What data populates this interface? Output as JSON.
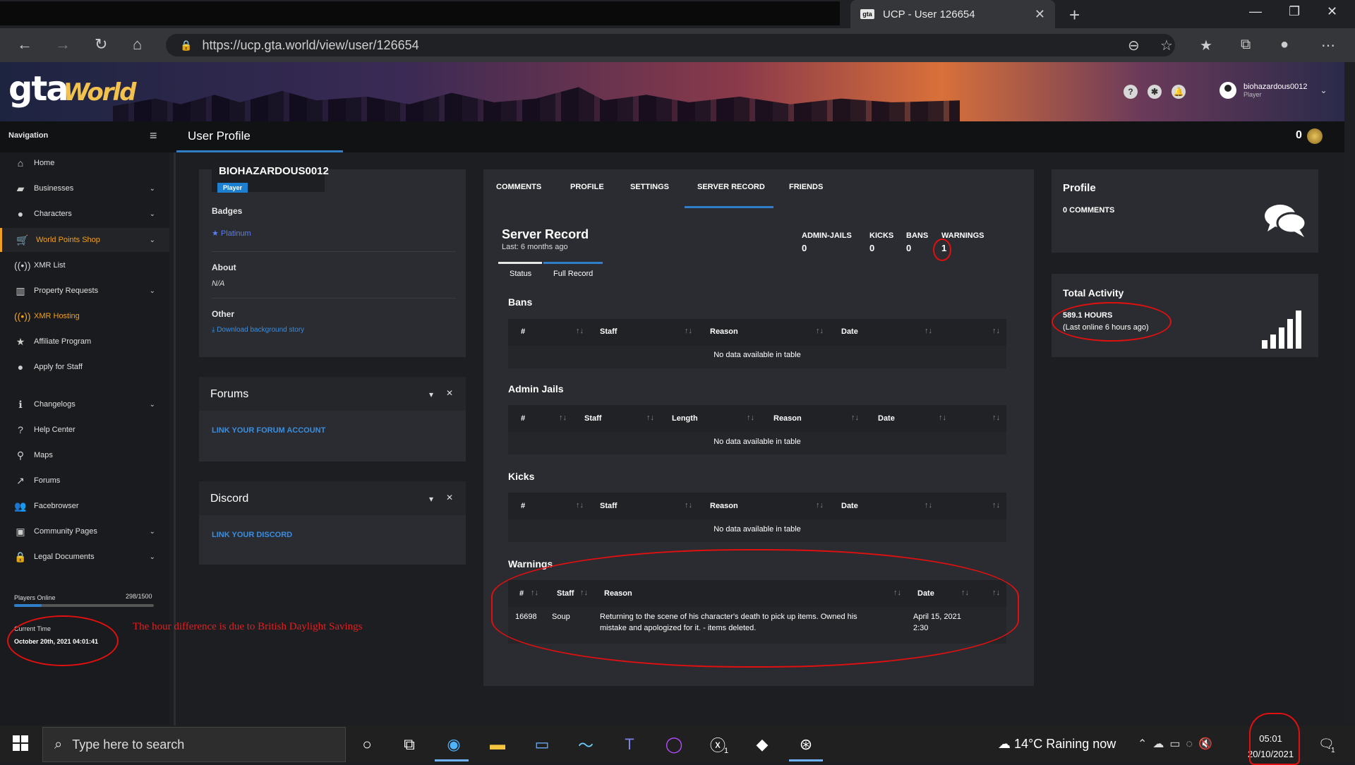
{
  "browser": {
    "tab_title": "UCP - User 126654",
    "favicon": "gta",
    "url": "https://ucp.gta.world/view/user/126654"
  },
  "header": {
    "logo_main": "gta",
    "logo_script": "World",
    "username": "biohazardous0012",
    "user_role": "Player"
  },
  "navbar": {
    "navigation_label": "Navigation",
    "page_title": "User Profile",
    "points": "0"
  },
  "sidebar": {
    "items": [
      {
        "label": "Home",
        "icon": "home-icon"
      },
      {
        "label": "Businesses",
        "icon": "briefcase-icon"
      },
      {
        "label": "Characters",
        "icon": "user-icon"
      },
      {
        "label": "World Points Shop",
        "icon": "cart-icon"
      },
      {
        "label": "XMR List",
        "icon": "broadcast-icon"
      },
      {
        "label": "Property Requests",
        "icon": "building-icon"
      },
      {
        "label": "XMR Hosting",
        "icon": "broadcast-icon"
      },
      {
        "label": "Affiliate Program",
        "icon": "star-icon"
      },
      {
        "label": "Apply for Staff",
        "icon": "user-tie-icon"
      },
      {
        "label": "Changelogs",
        "icon": "info-icon"
      },
      {
        "label": "Help Center",
        "icon": "question-icon"
      },
      {
        "label": "Maps",
        "icon": "map-pin-icon"
      },
      {
        "label": "Forums",
        "icon": "external-link-icon"
      },
      {
        "label": "Facebrowser",
        "icon": "users-icon"
      },
      {
        "label": "Community Pages",
        "icon": "window-icon"
      },
      {
        "label": "Legal Documents",
        "icon": "lock-icon"
      }
    ],
    "players_online_label": "Players Online",
    "players_online_count": "298/1500",
    "players_online_fraction": 0.199,
    "current_time_label": "Current Time",
    "current_time_value": "October 20th, 2021 04:01:41"
  },
  "annotation": {
    "note": "The hour difference is due to British Daylight Savings"
  },
  "profile_card": {
    "name": "BIOHAZARDOUS0012",
    "role": "Player",
    "badges_label": "Badges",
    "badge": "Platinum",
    "about_label": "About",
    "about_value": "N/A",
    "other_label": "Other",
    "download_link": "Download background story"
  },
  "forums_card": {
    "title": "Forums",
    "link": "LINK YOUR FORUM ACCOUNT"
  },
  "discord_card": {
    "title": "Discord",
    "link": "LINK YOUR DISCORD"
  },
  "center": {
    "tabs": [
      "COMMENTS",
      "PROFILE",
      "SETTINGS",
      "SERVER RECORD",
      "FRIENDS"
    ],
    "title": "Server Record",
    "subtitle": "Last: 6 months ago",
    "stats": [
      {
        "label": "ADMIN-JAILS",
        "value": "0"
      },
      {
        "label": "KICKS",
        "value": "0"
      },
      {
        "label": "BANS",
        "value": "0"
      },
      {
        "label": "WARNINGS",
        "value": "1"
      }
    ],
    "subtabs": [
      "Status",
      "Full Record"
    ],
    "no_data": "No data available in table",
    "bans": {
      "title": "Bans",
      "columns": [
        "#",
        "Staff",
        "Reason",
        "Date"
      ]
    },
    "jails": {
      "title": "Admin Jails",
      "columns": [
        "#",
        "Staff",
        "Length",
        "Reason",
        "Date"
      ]
    },
    "kicks": {
      "title": "Kicks",
      "columns": [
        "#",
        "Staff",
        "Reason",
        "Date"
      ]
    },
    "warnings": {
      "title": "Warnings",
      "columns": [
        "#",
        "Staff",
        "Reason",
        "Date"
      ],
      "rows": [
        {
          "id": "16698",
          "staff": "Soup",
          "reason_line1": "Returning to the scene of his character's death to pick up items. Owned his",
          "reason_line2": "mistake and apologized for it. - items deleted.",
          "date_line1": "April 15, 2021",
          "date_line2": "2:30"
        }
      ]
    }
  },
  "right": {
    "profile_title": "Profile",
    "comments": "0 COMMENTS",
    "activity_title": "Total Activity",
    "hours": "589.1 HOURS",
    "last_online": "(Last online 6 hours ago)"
  },
  "taskbar": {
    "search_placeholder": "Type here to search",
    "weather": "14°C  Raining now",
    "time": "05:01",
    "date": "20/10/2021",
    "xbox_badge": "1",
    "notif_badge": "1"
  },
  "colors": {
    "accent_blue": "#2f7ec7",
    "accent_orange": "#f0a020",
    "annotation_red": "#e01010"
  }
}
